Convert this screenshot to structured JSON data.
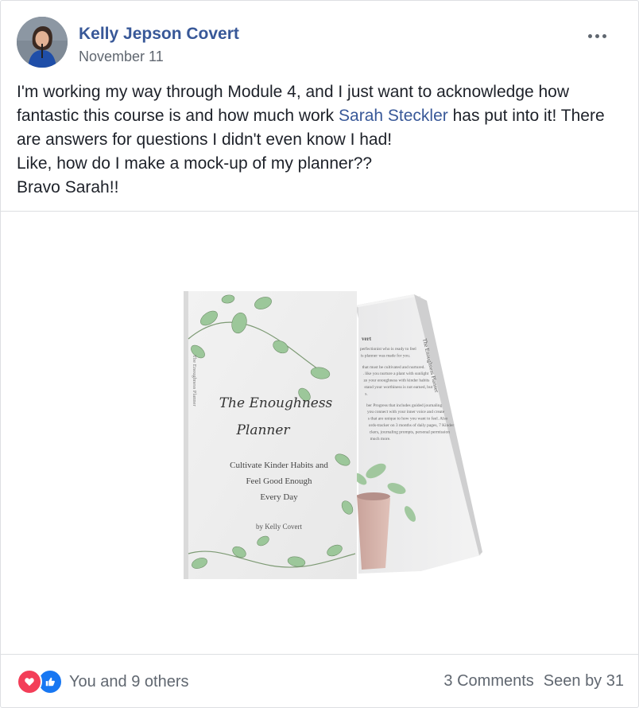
{
  "post": {
    "author": "Kelly Jepson Covert",
    "date": "November 11",
    "text_before": "I'm working my way through Module 4, and I just want to acknowledge how fantastic this course is and how much work ",
    "mention": "Sarah Steckler",
    "text_after": " has put into it! There are answers for questions I didn't even know I had!",
    "line2": "Like, how do I make a mock-up of my planner??",
    "line3": "Bravo Sarah!!",
    "more_icon": "ellipsis-icon"
  },
  "image": {
    "cover_title_line1": "The Enoughness",
    "cover_title_line2": "Planner",
    "cover_subtitle_1": "Cultivate Kinder Habits and",
    "cover_subtitle_2": "Feel Good Enough",
    "cover_subtitle_3": "Every Day",
    "cover_author": "by Kelly Covert",
    "spine_text": "The Enoughness Planner",
    "back_spine_text": "The Enoughness Planner",
    "back_heading": "vert",
    "back_lines": [
      "perfectionist who is ready to feel",
      "is planner was made for you.",
      "",
      "that must be cultivated and nurtured.",
      ". like you nurture a plant with sunlight",
      "ze your enoughness with kinder habits",
      "stand your worthiness is not earned, but",
      "s.",
      "",
      "ber Progress that includes guided journaling",
      "you connect with your inner voice and create",
      "s that are unique to how you want to feel. Also",
      "ords-tracker on 3 months of daily pages, 7 Kinder",
      "ckers, journaling prompts, personal permission",
      "much more."
    ]
  },
  "footer": {
    "reactions_label": "You and 9 others",
    "comments": "3 Comments",
    "seen_by": "Seen by 31"
  },
  "colors": {
    "link": "#385898",
    "love": "#f33e58",
    "like": "#1877f2",
    "muted": "#606770"
  }
}
